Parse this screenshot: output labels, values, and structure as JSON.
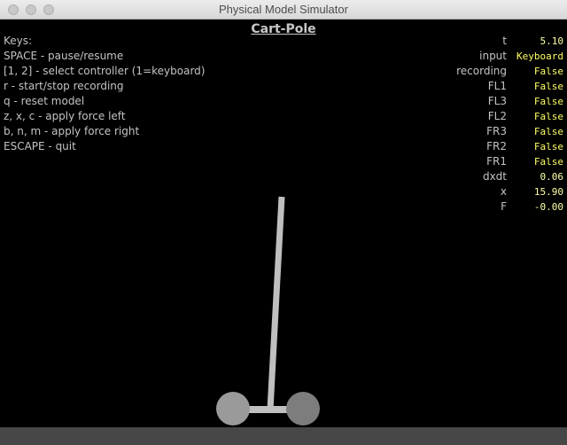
{
  "window": {
    "title": "Physical Model Simulator"
  },
  "scene": {
    "title": "Cart-Pole",
    "colors": {
      "background": "#000000",
      "pole": "#bfbfbf",
      "wheel_left": "#9a9a9a",
      "wheel_right": "#7d7d7d",
      "ground": "#474747",
      "text": "#c3c3c3",
      "value": "#ffff66"
    }
  },
  "keys": [
    "Keys:",
    "SPACE - pause/resume",
    "[1, 2] - select controller (1=keyboard)",
    "r - start/stop recording",
    "q - reset model",
    "z, x, c - apply force left",
    "b, n, m - apply force right",
    "ESCAPE - quit"
  ],
  "status": [
    {
      "label": "t",
      "value": "5.10"
    },
    {
      "label": "input",
      "value": "Keyboard"
    },
    {
      "label": "recording",
      "value": "False"
    },
    {
      "label": "FL1",
      "value": "False"
    },
    {
      "label": "FL3",
      "value": "False"
    },
    {
      "label": "FL2",
      "value": "False"
    },
    {
      "label": "FR3",
      "value": "False"
    },
    {
      "label": "FR2",
      "value": "False"
    },
    {
      "label": "FR1",
      "value": "False"
    },
    {
      "label": "dxdt",
      "value": "0.06"
    },
    {
      "label": "x",
      "value": "15.90"
    },
    {
      "label": "F",
      "value": "-0.00"
    }
  ]
}
